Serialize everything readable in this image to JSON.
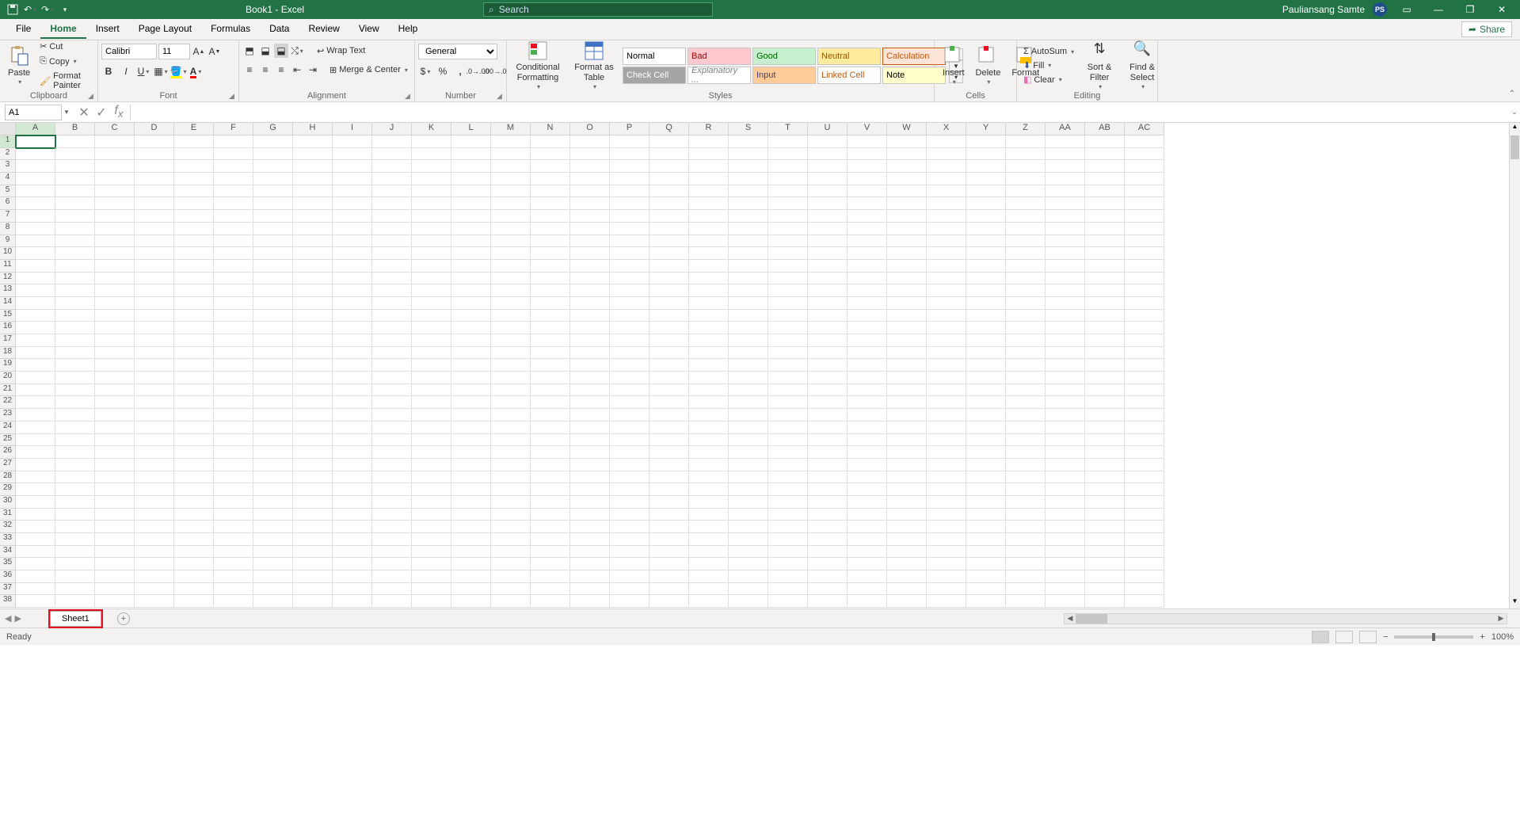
{
  "title": "Book1  -  Excel",
  "search_placeholder": "Search",
  "user": {
    "name": "Pauliansang Samte",
    "initials": "PS"
  },
  "tabs": [
    "File",
    "Home",
    "Insert",
    "Page Layout",
    "Formulas",
    "Data",
    "Review",
    "View",
    "Help"
  ],
  "active_tab": "Home",
  "share_label": "Share",
  "clipboard": {
    "cut": "Cut",
    "copy": "Copy",
    "paste": "Paste",
    "painter": "Format Painter",
    "label": "Clipboard"
  },
  "font": {
    "name": "Calibri",
    "size": "11",
    "label": "Font"
  },
  "alignment": {
    "wrap": "Wrap Text",
    "merge": "Merge & Center",
    "label": "Alignment"
  },
  "number": {
    "format": "General",
    "label": "Number"
  },
  "styles": {
    "cond": "Conditional Formatting",
    "fat": "Format as Table",
    "cells": [
      "Normal",
      "Bad",
      "Good",
      "Neutral",
      "Calculation",
      "Check Cell",
      "Explanatory ...",
      "Input",
      "Linked Cell",
      "Note"
    ],
    "label": "Styles"
  },
  "cells_group": {
    "insert": "Insert",
    "delete": "Delete",
    "format": "Format",
    "label": "Cells"
  },
  "editing": {
    "autosum": "AutoSum",
    "fill": "Fill",
    "clear": "Clear",
    "sort": "Sort & Filter",
    "find": "Find & Select",
    "label": "Editing"
  },
  "namebox": "A1",
  "columns": [
    "A",
    "B",
    "C",
    "D",
    "E",
    "F",
    "G",
    "H",
    "I",
    "J",
    "K",
    "L",
    "M",
    "N",
    "O",
    "P",
    "Q",
    "R",
    "S",
    "T",
    "U",
    "V",
    "W",
    "X",
    "Y",
    "Z",
    "AA",
    "AB",
    "AC"
  ],
  "row_count": 38,
  "active_cell": {
    "row": 1,
    "col": 0
  },
  "sheet_tab": "Sheet1",
  "status_text": "Ready",
  "zoom": "100%"
}
